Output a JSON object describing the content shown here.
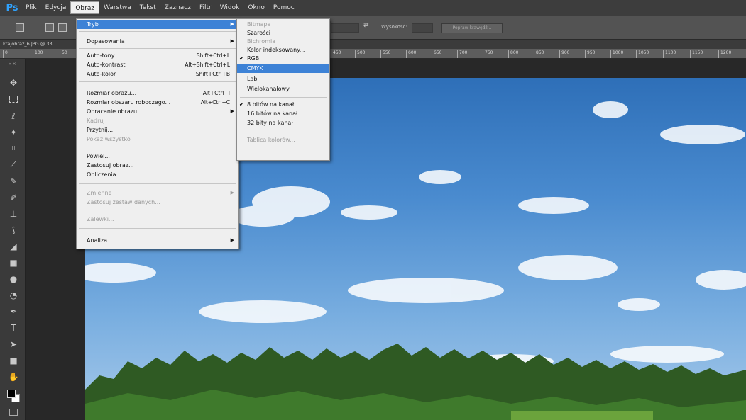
{
  "menubar": {
    "logo": "Ps",
    "items": [
      "Plik",
      "Edycja",
      "Obraz",
      "Warstwa",
      "Tekst",
      "Zaznacz",
      "Filtr",
      "Widok",
      "Okno",
      "Pomoc"
    ]
  },
  "options": {
    "height_label": "Wysokość:",
    "refine_button": "Popraw krawędź..."
  },
  "document": {
    "tab_title": "krajobraz_6.JPG @ 33,"
  },
  "ruler": {
    "ticks": [
      "0",
      "100",
      "50",
      "450",
      "500",
      "550",
      "600",
      "650",
      "700",
      "750",
      "800",
      "850",
      "900",
      "950",
      "1000",
      "1050",
      "1100",
      "1150",
      "1200"
    ]
  },
  "toolbox": {
    "header": "» ×"
  },
  "image_menu": {
    "mode": "Tryb",
    "adjustments": "Dopasowania",
    "auto_tone": "Auto-tony",
    "auto_tone_sc": "Shift+Ctrl+L",
    "auto_contrast": "Auto-kontrast",
    "auto_contrast_sc": "Alt+Shift+Ctrl+L",
    "auto_color": "Auto-kolor",
    "auto_color_sc": "Shift+Ctrl+B",
    "image_size": "Rozmiar obrazu...",
    "image_size_sc": "Alt+Ctrl+I",
    "canvas_size": "Rozmiar obszaru roboczego...",
    "canvas_size_sc": "Alt+Ctrl+C",
    "rotation": "Obracanie obrazu",
    "crop": "Kadruj",
    "trim": "Przytnij...",
    "reveal_all": "Pokaż wszystko",
    "duplicate": "Powiel...",
    "apply_image": "Zastosuj obraz...",
    "calculations": "Obliczenia...",
    "variables": "Zmienne",
    "apply_data_set": "Zastosuj zestaw danych...",
    "trap": "Zalewki...",
    "analysis": "Analiza"
  },
  "mode_submenu": {
    "bitmap": "Bitmapa",
    "grayscale": "Szarości",
    "duotone": "Bichromia",
    "indexed": "Kolor indeksowany...",
    "rgb": "RGB",
    "cmyk": "CMYK",
    "lab": "Lab",
    "multichannel": "Wielokanałowy",
    "bits8": "8 bitów na kanał",
    "bits16": "16 bitów na kanał",
    "bits32": "32 bity na kanał",
    "color_table": "Tablica kolorów...",
    "check": "✔"
  }
}
